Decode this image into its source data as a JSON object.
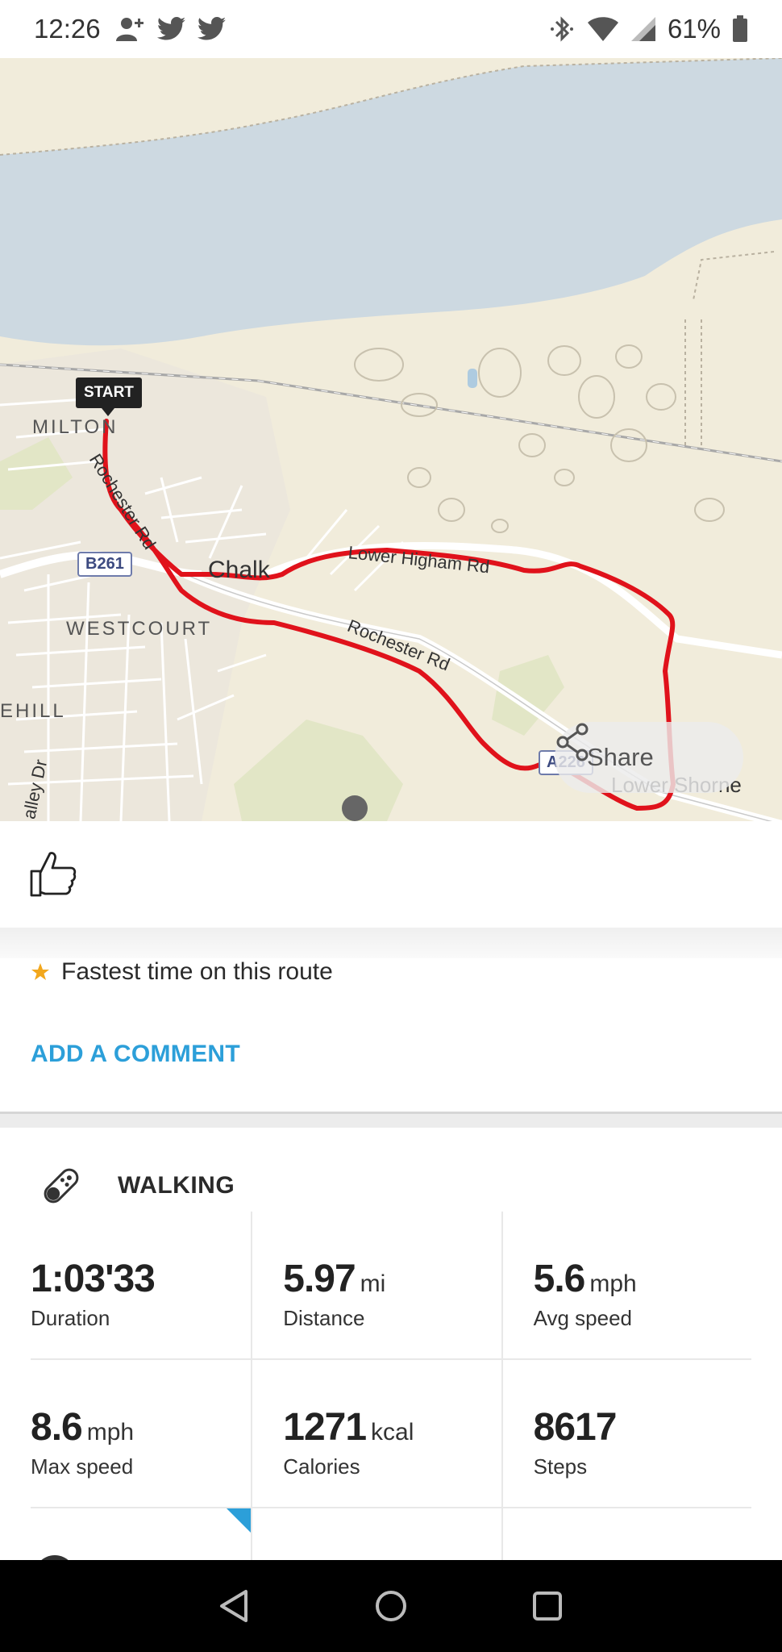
{
  "status_bar": {
    "time": "12:26",
    "battery_percent": "61%",
    "left_icons": [
      "add-person-icon",
      "twitter-icon",
      "twitter-icon"
    ],
    "right_icons": [
      "bluetooth-icon",
      "wifi-icon",
      "signal-icon",
      "battery-icon"
    ]
  },
  "map": {
    "place_labels": {
      "milton": "MILTON",
      "chalk": "Chalk",
      "westcourt": "WESTCOURT",
      "ehill": "EHILL",
      "lower_shorne": "Lower Shorne"
    },
    "road_labels": {
      "rochester_rd_1": "Rochester Rd",
      "rochester_rd_2": "Rochester Rd",
      "lower_higham_rd": "Lower Higham Rd",
      "valley_dr": "alley Dr"
    },
    "road_shields": {
      "b261": "B261",
      "a226": "A226"
    },
    "start_marker": "START",
    "share_label": "Share",
    "route_color": "#e0121b",
    "water_color": "#cdd9e1",
    "land_color": "#f1ecdb"
  },
  "feed": {
    "like_icon": "thumbs-up-icon",
    "achievement_icon": "star-icon",
    "achievement_text": "Fastest time on this route",
    "add_comment_label": "ADD A COMMENT"
  },
  "activity": {
    "icon": "shoe-icon",
    "title": "WALKING",
    "stats": [
      {
        "value": "1:03'33",
        "unit": "",
        "label": "Duration"
      },
      {
        "value": "5.97",
        "unit": "mi",
        "label": "Distance"
      },
      {
        "value": "5.6",
        "unit": "mph",
        "label": "Avg speed"
      },
      {
        "value": "8.6",
        "unit": "mph",
        "label": "Max speed"
      },
      {
        "value": "1271",
        "unit": "kcal",
        "label": "Calories"
      },
      {
        "value": "8617",
        "unit": "",
        "label": "Steps"
      }
    ],
    "accent_color": "#2c9fd9"
  },
  "nav_bar": {
    "icons": [
      "back-icon",
      "home-icon",
      "recents-icon"
    ]
  }
}
